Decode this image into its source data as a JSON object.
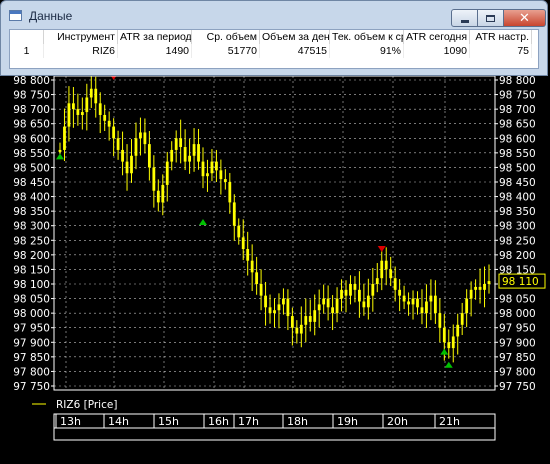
{
  "window": {
    "title": "Данные"
  },
  "table": {
    "columns": [
      "Инструмент",
      "ATR за период",
      "Ср. объем",
      "Объем за день",
      "Тек. объем к ср.",
      "ATR сегодня",
      "ATR настр."
    ],
    "row": {
      "index": "1",
      "cells": [
        "RIZ6",
        "1490",
        "51770",
        "47515",
        "91%",
        "1090",
        "75"
      ]
    }
  },
  "chart": {
    "legend": "RIZ6 [Price]",
    "current_price": "98 110",
    "time_labels": [
      "13h",
      "14h",
      "15h",
      "16h",
      "17h",
      "18h",
      "19h",
      "20h",
      "21h"
    ],
    "colors": {
      "background": "#000000",
      "candle": "#ffff00",
      "grid": "#ffffff",
      "marker_up": "#00c000",
      "marker_down": "#e00000"
    }
  },
  "chart_data": {
    "type": "line",
    "ylim": [
      97750,
      98800
    ],
    "y_ticks": [
      97750,
      97800,
      97850,
      97900,
      97950,
      98000,
      98050,
      98100,
      98150,
      98200,
      98250,
      98300,
      98350,
      98400,
      98450,
      98500,
      98550,
      98600,
      98650,
      98700,
      98750,
      98800
    ],
    "y_tick_labels": [
      "97 750",
      "97 800",
      "97 850",
      "97 900",
      "97 950",
      "98 000",
      "98 050",
      "98 100",
      "98 150",
      "98 200",
      "98 250",
      "98 300",
      "98 350",
      "98 400",
      "98 450",
      "98 500",
      "98 550",
      "98 600",
      "98 650",
      "98 700",
      "98 750",
      "98 800"
    ],
    "x_labels": [
      "13h",
      "14h",
      "15h",
      "16h",
      "17h",
      "18h",
      "19h",
      "20h",
      "21h"
    ],
    "series": [
      {
        "name": "RIZ6 [Price]",
        "values": [
          98560,
          98640,
          98720,
          98700,
          98680,
          98690,
          98740,
          98770,
          98720,
          98680,
          98660,
          98640,
          98600,
          98560,
          98520,
          98480,
          98540,
          98600,
          98620,
          98580,
          98500,
          98420,
          98380,
          98440,
          98520,
          98560,
          98600,
          98570,
          98520,
          98540,
          98580,
          98520,
          98470,
          98480,
          98520,
          98490,
          98460,
          98450,
          98380,
          98300,
          98260,
          98220,
          98180,
          98140,
          98100,
          98060,
          98020,
          98000,
          98010,
          98030,
          98050,
          97990,
          97950,
          97930,
          97960,
          97990,
          97970,
          98010,
          98030,
          98050,
          98020,
          98000,
          98050,
          98080,
          98060,
          98100,
          98080,
          98040,
          98020,
          98060,
          98100,
          98120,
          98180,
          98150,
          98120,
          98080,
          98060,
          98040,
          98030,
          98050,
          98020,
          98000,
          98040,
          98060,
          98000,
          97950,
          97900,
          97880,
          97920,
          97960,
          98000,
          98050,
          98080,
          98090,
          98080,
          98100,
          98110
        ]
      }
    ],
    "markers": [
      {
        "type": "low",
        "value": 98555
      },
      {
        "type": "high",
        "value": 98800
      },
      {
        "type": "low",
        "value": 98330
      },
      {
        "type": "high",
        "value": 98210
      },
      {
        "type": "low",
        "value": 97885
      },
      {
        "type": "low",
        "value": 97840
      }
    ]
  }
}
